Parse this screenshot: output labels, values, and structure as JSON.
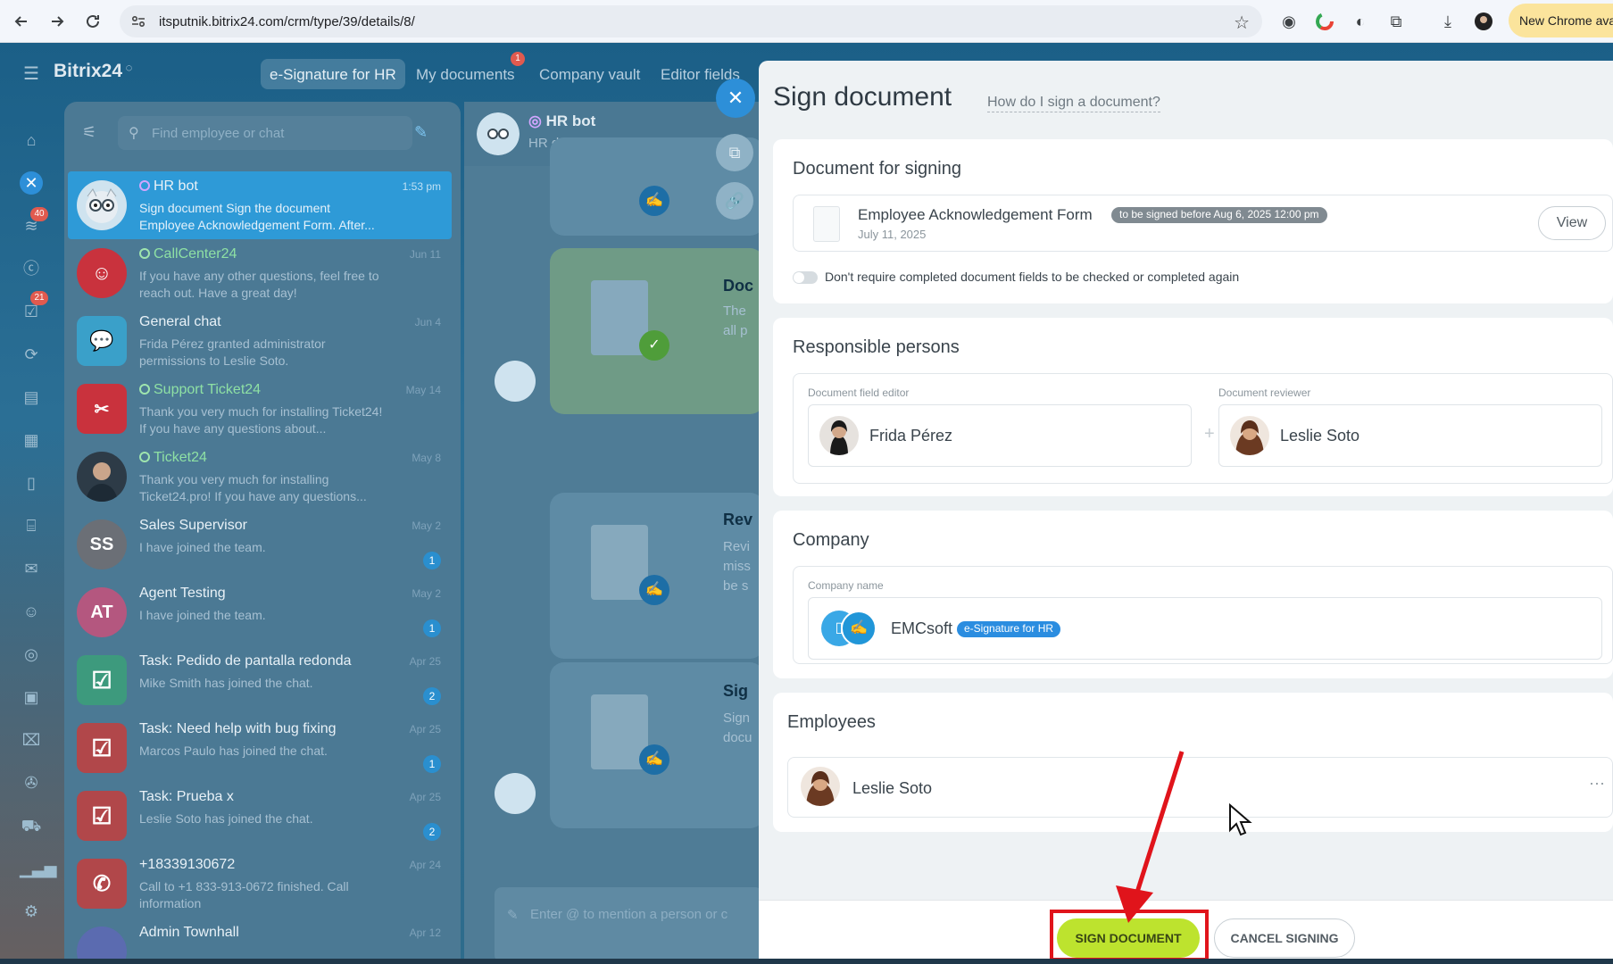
{
  "browser": {
    "url": "itsputnik.bitrix24.com/crm/type/39/details/8/",
    "new_chrome_label": "New Chrome avai"
  },
  "bitrix": {
    "logo": "Bitrix24",
    "top_tabs": [
      {
        "label": "e-Signature for HR",
        "active": true
      },
      {
        "label": "My documents",
        "badge": "1"
      },
      {
        "label": "Company vault"
      },
      {
        "label": "Editor fields"
      }
    ],
    "rail_badges": [
      "40",
      "21"
    ]
  },
  "chat_list": {
    "search_placeholder": "Find employee or chat",
    "items": [
      {
        "name": "HR bot",
        "snippet": "Sign document Sign the document Employee Acknowledgement Form. After...",
        "date": "1:53 pm",
        "active": true,
        "avatar": "bot"
      },
      {
        "name": "CallCenter24",
        "snippet": "If you have any other questions, feel free to reach out. Have a great day!",
        "date": "Jun 11",
        "avatar": "callcenter"
      },
      {
        "name": "General chat",
        "snippet": "Frida Pérez granted administrator permissions to Leslie Soto.",
        "date": "Jun 4",
        "avatar": "general"
      },
      {
        "name": "Support Ticket24",
        "snippet": "Thank you very much for installing Ticket24! If you have any questions about...",
        "date": "May 14",
        "avatar": "ticket"
      },
      {
        "name": "Ticket24",
        "snippet": "Thank you very much for installing Ticket24.pro! If you have any questions...",
        "date": "May 8",
        "avatar": "person"
      },
      {
        "name": "Sales Supervisor",
        "snippet": "I have joined the team.",
        "date": "May 2",
        "initials": "SS",
        "count": "1",
        "avatar": "initials"
      },
      {
        "name": "Agent Testing",
        "snippet": "I have joined the team.",
        "date": "May 2",
        "initials": "AT",
        "count": "1",
        "avatar": "initials"
      },
      {
        "name": "Task: Pedido de pantalla redonda",
        "snippet": "Mike Smith has joined the chat.",
        "date": "Apr 25",
        "count": "2",
        "avatar": "task-green"
      },
      {
        "name": "Task: Need help with bug fixing",
        "snippet": "Marcos Paulo has joined the chat.",
        "date": "Apr 25",
        "count": "1",
        "avatar": "task-red"
      },
      {
        "name": "Task: Prueba x",
        "snippet": "Leslie Soto has joined the chat.",
        "date": "Apr 25",
        "count": "2",
        "avatar": "task-red"
      },
      {
        "name": "+18339130672",
        "snippet": "Call to +1 833-913-0672 finished. Call information",
        "date": "Apr 24",
        "avatar": "phone"
      },
      {
        "name": "Admin Townhall",
        "snippet": "",
        "date": "Apr 12",
        "avatar": "group"
      }
    ]
  },
  "conversation": {
    "title": "HR bot",
    "subtitle": "HR document signing aid",
    "partial_texts": [
      "Doc",
      "The",
      "all p",
      "Rev",
      "Revi",
      "miss",
      "be s",
      "Sig",
      "Sign",
      "docu"
    ],
    "input_placeholder": "Enter @ to mention a person or c"
  },
  "sign_panel": {
    "title": "Sign document",
    "help_link": "How do I sign a document?",
    "doc_section": {
      "title": "Document for signing",
      "doc_name": "Employee Acknowledgement Form",
      "deadline_badge": "to be signed before Aug 6, 2025 12:00 pm",
      "doc_date": "July 11, 2025",
      "view_label": "View",
      "toggle_label": "Don't require completed document fields to be checked or completed again",
      "toggle_on": false
    },
    "responsible_section": {
      "title": "Responsible persons",
      "editor_label": "Document field editor",
      "editor_name": "Frida Pérez",
      "reviewer_label": "Document reviewer",
      "reviewer_name": "Leslie Soto"
    },
    "company_section": {
      "title": "Company",
      "field_label": "Company name",
      "company_name": "EMCsoft",
      "company_badge": "e-Signature for HR"
    },
    "employees_section": {
      "title": "Employees",
      "employee_name": "Leslie Soto"
    },
    "buttons": {
      "sign": "SIGN DOCUMENT",
      "cancel": "CANCEL SIGNING"
    }
  },
  "colors": {
    "accent_blue": "#2e9ad7",
    "sign_green": "#bde32e",
    "annotation_red": "#e0141b"
  }
}
